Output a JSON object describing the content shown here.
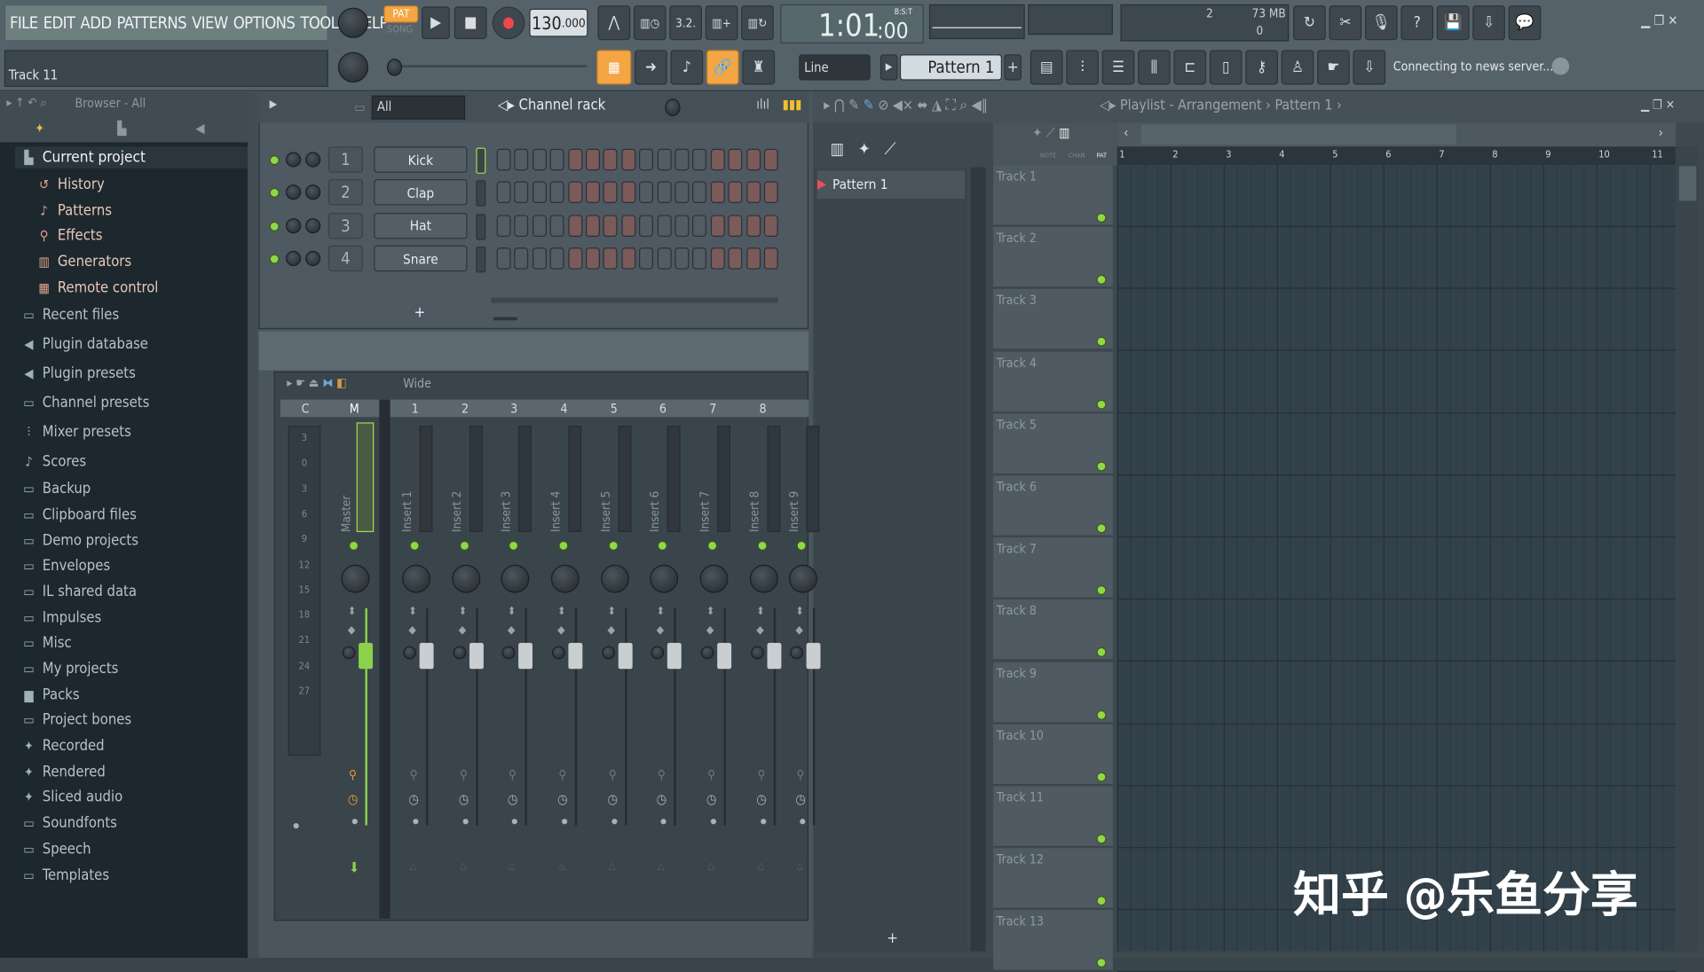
{
  "menu": [
    "FILE",
    "EDIT",
    "ADD",
    "PATTERNS",
    "VIEW",
    "OPTIONS",
    "TOOLS",
    "HELP"
  ],
  "hint_text": "Track 11",
  "transport": {
    "pat_label": "PAT",
    "song_label": "SONG",
    "tempo_int": "130",
    "tempo_dec": ".000",
    "time_main": "1:01",
    "time_sub": ":00",
    "time_format": "B:S:T"
  },
  "cpu": {
    "value": "2",
    "memory": "73 MB",
    "poly": "0"
  },
  "snap": "Line",
  "pattern_selector": "Pattern 1",
  "news": "Connecting to news server...",
  "accent": "#f4a544",
  "browser": {
    "title": "Browser - All",
    "items": [
      {
        "label": "Current project",
        "type": "hdr",
        "icon": "▙"
      },
      {
        "label": "History",
        "type": "sub",
        "icon": "↺"
      },
      {
        "label": "Patterns",
        "type": "sub",
        "icon": "♪"
      },
      {
        "label": "Effects",
        "type": "sub",
        "icon": "⚲"
      },
      {
        "label": "Generators",
        "type": "sub",
        "icon": "▥"
      },
      {
        "label": "Remote control",
        "type": "sub",
        "icon": "▦"
      },
      {
        "label": "Recent files",
        "icon": "▭"
      },
      {
        "label": "Plugin database",
        "icon": "◀"
      },
      {
        "label": "Plugin presets",
        "icon": "◀"
      },
      {
        "label": "Channel presets",
        "icon": "▭"
      },
      {
        "label": "Mixer presets",
        "icon": "⫶"
      },
      {
        "label": "Scores",
        "icon": "♪"
      },
      {
        "label": "Backup",
        "icon": "▭"
      },
      {
        "label": "Clipboard files",
        "icon": "▭"
      },
      {
        "label": "Demo projects",
        "icon": "▭"
      },
      {
        "label": "Envelopes",
        "icon": "▭"
      },
      {
        "label": "IL shared data",
        "icon": "▭"
      },
      {
        "label": "Impulses",
        "icon": "▭"
      },
      {
        "label": "Misc",
        "icon": "▭"
      },
      {
        "label": "My projects",
        "icon": "▭"
      },
      {
        "label": "Packs",
        "icon": "▆"
      },
      {
        "label": "Project bones",
        "icon": "▭"
      },
      {
        "label": "Recorded",
        "icon": "✦"
      },
      {
        "label": "Rendered",
        "icon": "✦"
      },
      {
        "label": "Sliced audio",
        "icon": "✦"
      },
      {
        "label": "Soundfonts",
        "icon": "▭"
      },
      {
        "label": "Speech",
        "icon": "▭"
      },
      {
        "label": "Templates",
        "icon": "▭"
      }
    ]
  },
  "channel_rack": {
    "title": "Channel rack",
    "filter": "All",
    "add": "+",
    "channels": [
      {
        "num": "1",
        "name": "Kick"
      },
      {
        "num": "2",
        "name": "Clap"
      },
      {
        "num": "3",
        "name": "Hat"
      },
      {
        "num": "4",
        "name": "Snare"
      }
    ],
    "step_pattern": [
      0,
      0,
      0,
      0,
      1,
      1,
      1,
      1,
      0,
      0,
      0,
      0,
      1,
      1,
      1,
      1
    ]
  },
  "mixer": {
    "preset": "Wide",
    "header": [
      "C",
      "M",
      "1",
      "2",
      "3",
      "4",
      "5",
      "6",
      "7",
      "8"
    ],
    "meter_scale": [
      "3",
      "0",
      "3",
      "6",
      "9",
      "12",
      "15",
      "18",
      "21",
      "24",
      "27"
    ],
    "strips": [
      "Master",
      "Insert 1",
      "Insert 2",
      "Insert 3",
      "Insert 4",
      "Insert 5",
      "Insert 6",
      "Insert 7",
      "Insert 8",
      "Insert 9"
    ]
  },
  "playlist": {
    "title": "Playlist - Arrangement",
    "crumb": "Pattern 1",
    "pattern_list": [
      "Pattern 1"
    ],
    "add": "+",
    "modes": [
      "NOTE",
      "CHAN",
      "PAT"
    ],
    "ruler": [
      "1",
      "2",
      "3",
      "4",
      "5",
      "6",
      "7",
      "8",
      "9",
      "10",
      "11"
    ],
    "tracks": [
      "Track 1",
      "Track 2",
      "Track 3",
      "Track 4",
      "Track 5",
      "Track 6",
      "Track 7",
      "Track 8",
      "Track 9",
      "Track 10",
      "Track 11",
      "Track 12",
      "Track 13"
    ]
  },
  "watermark": "知乎 @乐鱼分享"
}
